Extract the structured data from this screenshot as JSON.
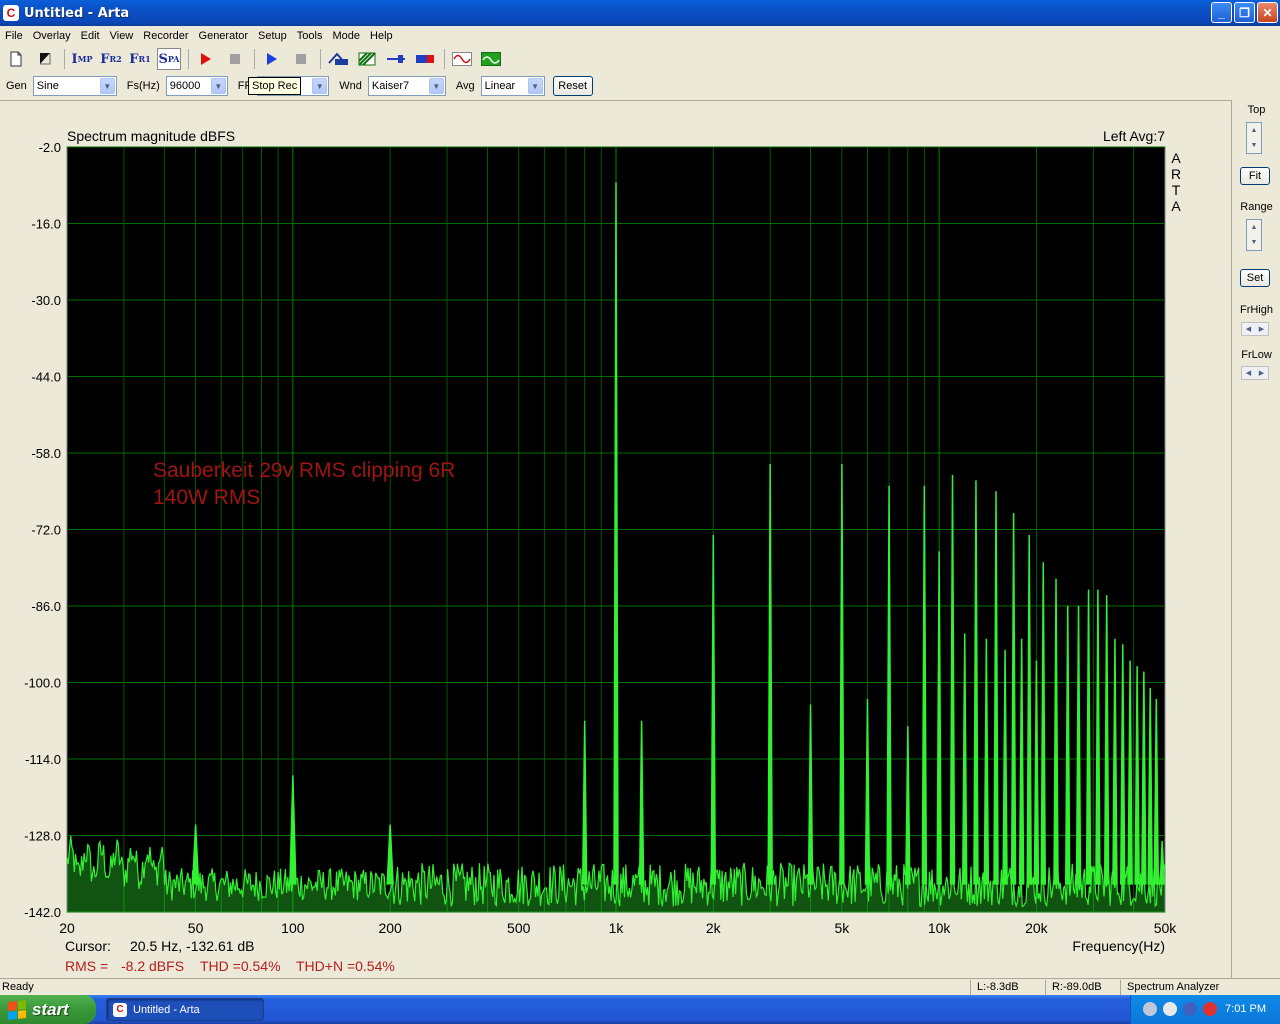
{
  "window": {
    "title": "Untitled - Arta",
    "app_icon_letter": "C",
    "minimize": "_",
    "maximize": "❐",
    "close": "✕"
  },
  "menu": [
    "File",
    "Overlay",
    "Edit",
    "View",
    "Recorder",
    "Generator",
    "Setup",
    "Tools",
    "Mode",
    "Help"
  ],
  "toolbar": {
    "imp": {
      "big": "I",
      "small": "MP"
    },
    "fr2": {
      "big": "F",
      "small": "R2"
    },
    "fr1": {
      "big": "F",
      "small": "R1"
    },
    "spa": {
      "big": "S",
      "small": "PA"
    }
  },
  "params": {
    "gen_label": "Gen",
    "gen_value": "Sine",
    "fs_label": "Fs(Hz)",
    "fs_value": "96000",
    "fft_label": "FF",
    "wnd_label": "Wnd",
    "wnd_value": "Kaiser7",
    "avg_label": "Avg",
    "avg_value": "Linear",
    "reset_label": "Reset",
    "tooltip": "Stop Rec"
  },
  "right_panel": {
    "top_label": "Top",
    "fit_label": "Fit",
    "range_label": "Range",
    "set_label": "Set",
    "frhigh_label": "FrHigh",
    "frlow_label": "FrLow"
  },
  "plot": {
    "title": "Spectrum magnitude dBFS",
    "channel_info": "Left  Avg:7",
    "brand_letters": [
      "A",
      "R",
      "T",
      "A"
    ],
    "annotation_line1": "Sauberkeit 29v RMS clipping 6R",
    "annotation_line2": "140W RMS",
    "cursor_label": "Cursor:",
    "cursor_value": "20.5 Hz, -132.61 dB",
    "xlabel": "Frequency(Hz)",
    "rms_label": "RMS =",
    "rms_value": "-8.2 dBFS",
    "thd": "THD =0.54%",
    "thdn": "THD+N =0.54%"
  },
  "chart_data": {
    "type": "line",
    "title": "Spectrum magnitude dBFS",
    "xlabel": "Frequency(Hz)",
    "ylabel": "",
    "x_scale": "log",
    "xlim": [
      20,
      50000
    ],
    "ylim": [
      -142,
      -2
    ],
    "grid": true,
    "y_ticks": [
      "-2.0",
      "-16.0",
      "-30.0",
      "-44.0",
      "-58.0",
      "-72.0",
      "-86.0",
      "-100.0",
      "-114.0",
      "-128.0",
      "-142.0"
    ],
    "x_ticks": [
      {
        "f": 20,
        "label": "20"
      },
      {
        "f": 50,
        "label": "50"
      },
      {
        "f": 100,
        "label": "100"
      },
      {
        "f": 200,
        "label": "200"
      },
      {
        "f": 500,
        "label": "500"
      },
      {
        "f": 1000,
        "label": "1k"
      },
      {
        "f": 2000,
        "label": "2k"
      },
      {
        "f": 5000,
        "label": "5k"
      },
      {
        "f": 10000,
        "label": "10k"
      },
      {
        "f": 20000,
        "label": "20k"
      },
      {
        "f": 50000,
        "label": "50k"
      }
    ],
    "noise_floor_db": -137,
    "series": [
      {
        "values_note_free": true,
        "peaks": [
          {
            "f": 50,
            "db": -126
          },
          {
            "f": 100,
            "db": -117
          },
          {
            "f": 200,
            "db": -126
          },
          {
            "f": 800,
            "db": -107
          },
          {
            "f": 1000,
            "db": -8.5
          },
          {
            "f": 1200,
            "db": -107
          },
          {
            "f": 2000,
            "db": -73
          },
          {
            "f": 3000,
            "db": -60
          },
          {
            "f": 4000,
            "db": -104
          },
          {
            "f": 5000,
            "db": -60
          },
          {
            "f": 6000,
            "db": -103
          },
          {
            "f": 7000,
            "db": -64
          },
          {
            "f": 8000,
            "db": -108
          },
          {
            "f": 9000,
            "db": -64
          },
          {
            "f": 10000,
            "db": -76
          },
          {
            "f": 11000,
            "db": -62
          },
          {
            "f": 12000,
            "db": -91
          },
          {
            "f": 13000,
            "db": -63
          },
          {
            "f": 14000,
            "db": -92
          },
          {
            "f": 15000,
            "db": -65
          },
          {
            "f": 16000,
            "db": -94
          },
          {
            "f": 17000,
            "db": -69
          },
          {
            "f": 18000,
            "db": -92
          },
          {
            "f": 19000,
            "db": -73
          },
          {
            "f": 20000,
            "db": -96
          },
          {
            "f": 21000,
            "db": -78
          },
          {
            "f": 23000,
            "db": -81
          },
          {
            "f": 25000,
            "db": -86
          },
          {
            "f": 27000,
            "db": -86
          },
          {
            "f": 29000,
            "db": -83
          },
          {
            "f": 31000,
            "db": -83
          },
          {
            "f": 33000,
            "db": -84
          },
          {
            "f": 35000,
            "db": -92
          },
          {
            "f": 37000,
            "db": -93
          },
          {
            "f": 39000,
            "db": -96
          },
          {
            "f": 41000,
            "db": -97
          },
          {
            "f": 43000,
            "db": -98
          },
          {
            "f": 45000,
            "db": -101
          },
          {
            "f": 47000,
            "db": -103
          },
          {
            "f": 49000,
            "db": -129
          }
        ]
      }
    ]
  },
  "status": {
    "ready": "Ready",
    "left_level": "L:-8.3dB",
    "right_level": "R:-89.0dB",
    "mode": "Spectrum Analyzer"
  },
  "taskbar": {
    "start": "start",
    "task": "Untitled - Arta",
    "clock": "7:01 PM"
  },
  "colors": {
    "plot_bg": "#000000",
    "grid": "#006e00",
    "trace": "#32f032",
    "annotation": "#a01414",
    "rms_text": "#b41e1e"
  }
}
